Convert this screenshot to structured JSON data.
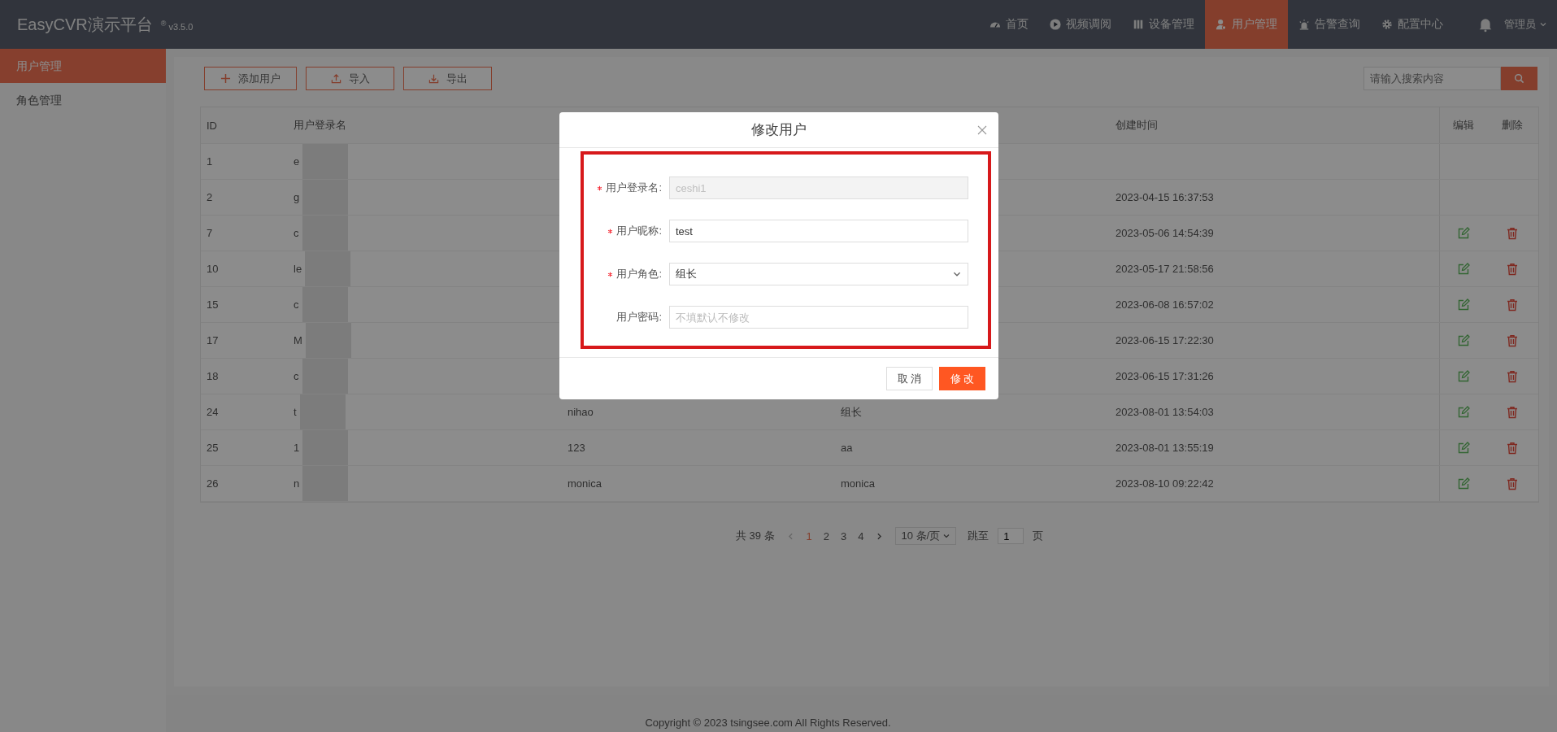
{
  "header": {
    "logo": "EasyCVR演示平台",
    "version_mark": "®",
    "version": "v3.5.0",
    "nav": [
      {
        "label": "首页",
        "selected": false
      },
      {
        "label": "视频调阅",
        "selected": false
      },
      {
        "label": "设备管理",
        "selected": false
      },
      {
        "label": "用户管理",
        "selected": true
      },
      {
        "label": "告警查询",
        "selected": false
      },
      {
        "label": "配置中心",
        "selected": false
      }
    ],
    "user": "管理员"
  },
  "sidebar": {
    "items": [
      {
        "label": "用户管理",
        "selected": true
      },
      {
        "label": "角色管理",
        "selected": false
      }
    ]
  },
  "toolbar": {
    "buttons": [
      {
        "label": "添加用户"
      },
      {
        "label": "导入"
      },
      {
        "label": "导出"
      }
    ],
    "search": {
      "placeholder": "请输入搜索内容"
    }
  },
  "table": {
    "columns": [
      "ID",
      "用户登录名",
      "",
      "",
      "创建时间",
      "编辑",
      "删除"
    ],
    "rows": [
      {
        "id": "1",
        "login": "e",
        "column_3": "",
        "column_4": "",
        "created": "",
        "actions": false
      },
      {
        "id": "2",
        "login": "g",
        "column_3": "",
        "column_4": "",
        "created": "2023-04-15 16:37:53",
        "actions": false
      },
      {
        "id": "7",
        "login": "c",
        "column_3": "",
        "column_4": "",
        "created": "2023-05-06 14:54:39",
        "actions": true
      },
      {
        "id": "10",
        "login": "le",
        "column_3": "",
        "column_4": "",
        "created": "2023-05-17 21:58:56",
        "actions": true
      },
      {
        "id": "15",
        "login": "c",
        "column_3": "",
        "column_4": "",
        "created": "2023-06-08 16:57:02",
        "actions": true
      },
      {
        "id": "17",
        "login": "M",
        "column_3": "",
        "column_4": "",
        "created": "2023-06-15 17:22:30",
        "actions": true
      },
      {
        "id": "18",
        "login": "c",
        "column_3": "",
        "column_4": "",
        "created": "2023-06-15 17:31:26",
        "actions": true
      },
      {
        "id": "24",
        "login": "t",
        "column_3": "nihao",
        "column_4": "组长",
        "created": "2023-08-01 13:54:03",
        "actions": true
      },
      {
        "id": "25",
        "login": "1",
        "column_3": "123",
        "column_4": "aa",
        "created": "2023-08-01 13:55:19",
        "actions": true
      },
      {
        "id": "26",
        "login": "n",
        "column_3": "monica",
        "column_4": "monica",
        "created": "2023-08-10 09:22:42",
        "actions": true
      }
    ]
  },
  "pagination": {
    "total": "共 39 条",
    "pages": [
      {
        "label": "1",
        "selected": true
      },
      {
        "label": "2",
        "selected": false
      },
      {
        "label": "3",
        "selected": false
      },
      {
        "label": "4",
        "selected": false
      }
    ],
    "page_size": "10 条/页",
    "jump_label": "跳至",
    "jump_value": "1",
    "page_unit": "页"
  },
  "footer": "Copyright © 2023 tsingsee.com All Rights Reserved.",
  "dialog": {
    "title": "修改用户",
    "fields": [
      {
        "label": "用户登录名:",
        "kind": "text",
        "required": true,
        "disabled": true,
        "value": "ceshi1"
      },
      {
        "label": "用户昵称:",
        "kind": "text",
        "required": true,
        "disabled": false,
        "value": "test"
      },
      {
        "label": "用户角色:",
        "kind": "select",
        "required": true,
        "disabled": false,
        "value": "组长"
      },
      {
        "label": "用户密码:",
        "kind": "text",
        "required": false,
        "disabled": false,
        "placeholder": "不填默认不修改"
      }
    ],
    "buttons": [
      {
        "label": "取 消",
        "kind": "secondary"
      },
      {
        "label": "修 改",
        "kind": "primary"
      }
    ]
  }
}
